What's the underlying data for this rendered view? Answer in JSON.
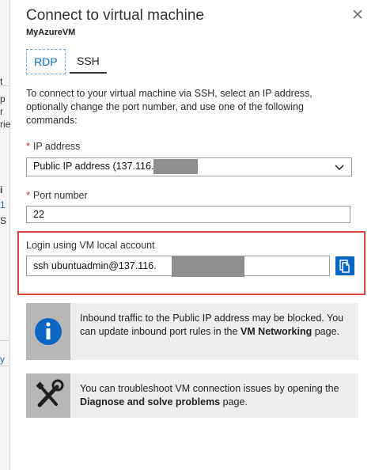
{
  "background": {
    "edge_marks": [
      "t",
      "p",
      "r",
      "rie",
      "i",
      "1",
      "S",
      "y"
    ]
  },
  "blade": {
    "title": "Connect to virtual machine",
    "subtitle": "MyAzureVM",
    "close_icon": "close-icon"
  },
  "tabs": [
    {
      "label": "RDP",
      "selected": false
    },
    {
      "label": "SSH",
      "selected": true
    }
  ],
  "intro_text": "To connect to your virtual machine via SSH, select an IP address, optionally change the port number, and use one of the following commands:",
  "ip_address": {
    "required_mark": "*",
    "label": "IP address",
    "value": "Public IP address (137.116.",
    "icon": "chevron-down-icon"
  },
  "port": {
    "required_mark": "*",
    "label": "Port number",
    "value": "22"
  },
  "login": {
    "label": "Login using VM local account",
    "command": "ssh ubuntuadmin@137.116.",
    "copy_icon": "copy-icon"
  },
  "info_boxes": [
    {
      "icon": "info-icon",
      "text_1": "Inbound traffic to the Public IP address may be blocked. You can update inbound port rules in the ",
      "bold": "VM Networking",
      "text_2": " page."
    },
    {
      "icon": "tools-icon",
      "text_1": "You can troubleshoot VM connection issues by opening the ",
      "bold": "Diagnose and solve problems",
      "text_2": " page."
    }
  ],
  "colors": {
    "accent": "#0072c6",
    "highlight_border": "#d9433a",
    "required": "#c2272d",
    "redaction": "#8e8e8e"
  }
}
